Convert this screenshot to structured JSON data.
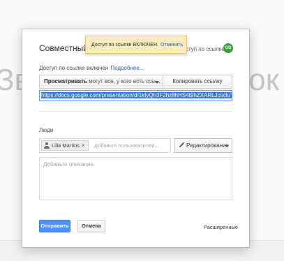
{
  "background": {
    "title_left": "Зв",
    "title_right": "ок"
  },
  "dialog": {
    "title": "Совместный до",
    "owner_label": "ступ по ссылке",
    "avatar_initials": "GD",
    "avatar_color": "#3a9a3a"
  },
  "notice": {
    "message": "Доступ по ссылке ВКЛЮЧЕН.",
    "undo_label": "Отменить"
  },
  "link_sharing": {
    "status_text": "Доступ по ссылке включен",
    "more_link": "Подробнее...",
    "access_bold": "Просматривать",
    "access_rest": "могут все, у кого есть ссы...",
    "copy_button": "Копировать ссылку",
    "url": "https://docs.google.com/presentation/d/1kIyQh3F2hz8hHS4t9hZXARLJcscluTpLZc"
  },
  "people": {
    "label": "Люди",
    "chip_name": "Lilia Martins",
    "chip_remove": "×",
    "add_placeholder": "Добавьте пользователей...",
    "permission_label": "Редактирование",
    "description_placeholder": "Добавьте описание"
  },
  "footer": {
    "send_button": "Отправить",
    "cancel_button": "Отмена",
    "advanced_link": "Расширенные"
  },
  "colors": {
    "accent_blue": "#4d90fe",
    "link_blue": "#2a5db0",
    "notice_bg": "#f9edbe",
    "selection": "#3875d7"
  }
}
